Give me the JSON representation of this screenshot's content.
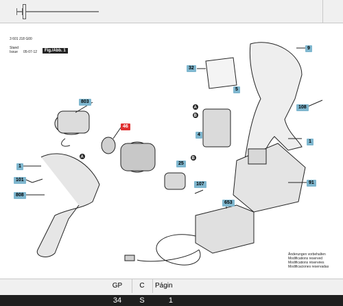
{
  "document": {
    "doc_number": "3 601 J18 G00",
    "stand_label": "Stand",
    "issue_label": "Issue",
    "stand_date": "05-07-12",
    "figure_label": "Fig./Abb. 1",
    "notes": [
      "Änderungen vorbehalten",
      "Modifications reserved",
      "Modifications réservées",
      "Modificaciones reservadas"
    ]
  },
  "part_labels": [
    {
      "text": "9"
    },
    {
      "text": "32"
    },
    {
      "text": "5"
    },
    {
      "text": "803"
    },
    {
      "text": "46"
    },
    {
      "text": "108"
    },
    {
      "text": "1"
    },
    {
      "text": "4"
    },
    {
      "text": "1"
    },
    {
      "text": "25"
    },
    {
      "text": "101"
    },
    {
      "text": "107"
    },
    {
      "text": "808"
    },
    {
      "text": "91"
    },
    {
      "text": "653"
    }
  ],
  "callouts": [
    "A",
    "B",
    "A",
    "B"
  ],
  "table": {
    "headers": [
      "GP",
      "C",
      "Págin"
    ],
    "row": [
      "34",
      "S",
      "1"
    ]
  }
}
